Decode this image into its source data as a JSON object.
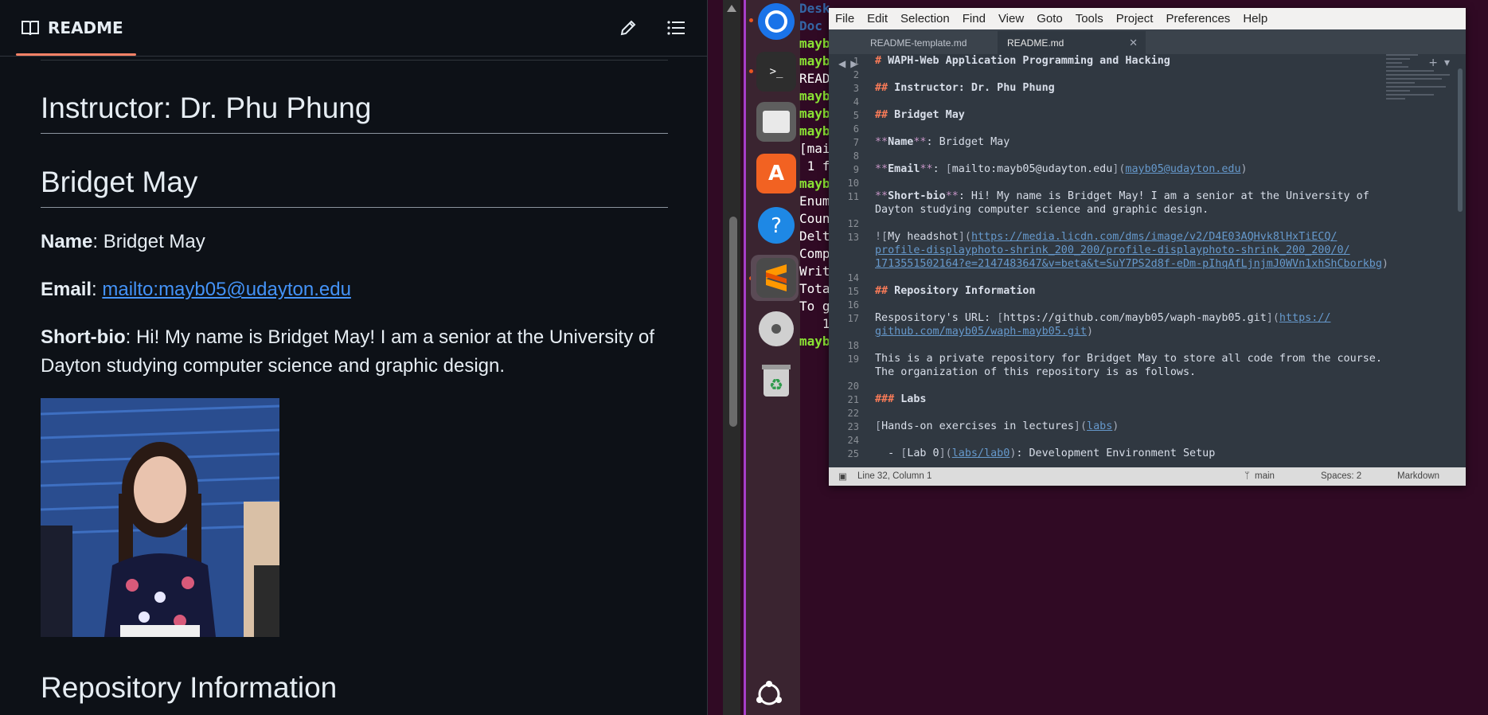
{
  "github": {
    "tab_label": "README",
    "instructor_heading": "Instructor: Dr. Phu Phung",
    "name_heading": "Bridget May",
    "name_label": "Name",
    "name_value": ": Bridget May",
    "email_label": "Email",
    "email_link": "mailto:mayb05@udayton.edu",
    "bio_label": "Short-bio",
    "bio_line1": ": Hi! My name is Bridget May! I am a senior at the University of",
    "bio_line2": "Dayton studying computer science and graphic design.",
    "repo_heading": "Repository Information"
  },
  "terminal": {
    "lines": [
      "Desk",
      "Doc",
      "mayb",
      "mayb",
      "READ",
      "mayb",
      "mayb",
      "mayb",
      "[mai",
      " 1 f",
      "mayb",
      "Enum",
      "Coun",
      "Delt",
      "Comp",
      "Writ",
      "Tota",
      "To g",
      "   1",
      "mayb"
    ]
  },
  "sublime": {
    "menu": [
      "File",
      "Edit",
      "Selection",
      "Find",
      "View",
      "Goto",
      "Tools",
      "Project",
      "Preferences",
      "Help"
    ],
    "tabs": [
      {
        "label": "README-template.md",
        "active": false
      },
      {
        "label": "README.md",
        "active": true
      }
    ],
    "gutter": [
      "1",
      "2",
      "3",
      "4",
      "5",
      "6",
      "7",
      "8",
      "9",
      "10",
      "11",
      "",
      "12",
      "13",
      "",
      "",
      "14",
      "15",
      "16",
      "17",
      "",
      "18",
      "19",
      "",
      "20",
      "21",
      "22",
      "23",
      "24",
      "25"
    ],
    "lines": {
      "l1_mark": "#",
      "l1_text": " WAPH-Web Application Programming and Hacking",
      "l3_mark": "##",
      "l3_text": " Instructor: Dr. Phu Phung",
      "l5_mark": "##",
      "l5_text": " Bridget May",
      "l7_a": "**",
      "l7_b": "Name",
      "l7_c": "**",
      "l7_d": ": Bridget May",
      "l9_a": "**",
      "l9_b": "Email",
      "l9_c": "**",
      "l9_d": ": ",
      "l9_e": "[",
      "l9_f": "mailto:mayb05@udayton.edu",
      "l9_g": "](",
      "l9_h": "mayb05@udayton.edu",
      "l9_i": ")",
      "l11_a": "**",
      "l11_b": "Short-bio",
      "l11_c": "**",
      "l11_d": ": Hi! My name is Bridget May! I am a senior at the University of",
      "l11_wrap": "Dayton studying computer science and graphic design.",
      "l13_a": "![",
      "l13_b": "My headshot",
      "l13_c": "](",
      "l13_d": "https://media.licdn.com/dms/image/v2/D4E03AQHvk8lHxTiECQ/",
      "l13_wrap1": "profile-displayphoto-shrink_200_200/profile-displayphoto-shrink_200_200/0/",
      "l13_wrap2": "1713551502164?e=2147483647&v=beta&t=SuY7PS2d8f-eDm-pIhqAfLjnjmJ0WVn1xhShCborkbg",
      "l13_e": ")",
      "l15_mark": "##",
      "l15_text": " Repository Information",
      "l17_a": "Respository's URL: ",
      "l17_b": "[",
      "l17_c": "https://github.com/mayb05/waph-mayb05.git",
      "l17_d": "](",
      "l17_e": "https://",
      "l17_wrap": "github.com/mayb05/waph-mayb05.git",
      "l17_f": ")",
      "l19_text": "This is a private repository for Bridget May to store all code from the course.",
      "l19_wrap": "The organization of this repository is as follows.",
      "l21_mark": "###",
      "l21_text": " Labs",
      "l23_a": "[",
      "l23_b": "Hands-on exercises in lectures",
      "l23_c": "](",
      "l23_d": "labs",
      "l23_e": ")",
      "l25_a": "  - ",
      "l25_b": "[",
      "l25_c": "Lab 0",
      "l25_d": "](",
      "l25_e": "labs/lab0",
      "l25_f": ")",
      "l25_g": ": Development Environment Setup"
    },
    "status": {
      "position": "Line 32, Column 1",
      "branch": "main",
      "spaces": "Spaces: 2",
      "syntax": "Markdown"
    }
  },
  "colors": {
    "github_bg": "#0d1117",
    "link": "#4493f8",
    "sublime_bg": "#303841",
    "heading_mark": "#f97b58",
    "desktop": "#300a24"
  }
}
